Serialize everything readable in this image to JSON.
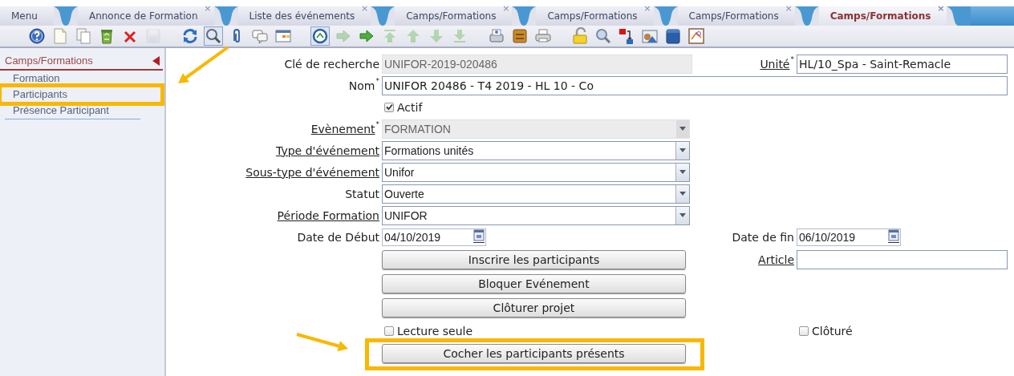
{
  "tabs": [
    {
      "label": "Menu",
      "selected": false
    },
    {
      "label": "Annonce de Formation",
      "close": "×",
      "selected": false
    },
    {
      "label": "Liste des événements",
      "close": "×",
      "selected": false
    },
    {
      "label": "Camps/Formations",
      "close": "×",
      "selected": false
    },
    {
      "label": "Camps/Formations",
      "close": "×",
      "selected": false
    },
    {
      "label": "Camps/Formations",
      "close": "×",
      "selected": false
    },
    {
      "label": "Camps/Formations",
      "close": "×",
      "selected": true
    }
  ],
  "toolbar": [
    {
      "kind": "help",
      "disabled": false,
      "pressed": false
    },
    {
      "kind": "new",
      "disabled": false,
      "pressed": false
    },
    {
      "kind": "copy",
      "disabled": false,
      "pressed": false
    },
    {
      "kind": "recycle",
      "disabled": false,
      "pressed": false
    },
    {
      "kind": "delete",
      "disabled": false,
      "pressed": false
    },
    {
      "kind": "save",
      "disabled": true,
      "pressed": false
    },
    {
      "kind": "refresh",
      "disabled": false,
      "pressed": false
    },
    {
      "kind": "search",
      "disabled": false,
      "pressed": true
    },
    {
      "kind": "clip",
      "disabled": false,
      "pressed": false
    },
    {
      "kind": "comments",
      "disabled": false,
      "pressed": false
    },
    {
      "kind": "table",
      "disabled": false,
      "pressed": false
    },
    {
      "kind": "history",
      "disabled": false,
      "pressed": true
    },
    {
      "kind": "forward",
      "disabled": true,
      "pressed": false
    },
    {
      "kind": "forward",
      "disabled": false,
      "pressed": false
    },
    {
      "kind": "top",
      "disabled": true,
      "pressed": false
    },
    {
      "kind": "up",
      "disabled": true,
      "pressed": false
    },
    {
      "kind": "down",
      "disabled": true,
      "pressed": false
    },
    {
      "kind": "bottom",
      "disabled": true,
      "pressed": false
    },
    {
      "kind": "scanner",
      "disabled": false,
      "pressed": false
    },
    {
      "kind": "drawer",
      "disabled": false,
      "pressed": false
    },
    {
      "kind": "printer",
      "disabled": false,
      "pressed": false
    },
    {
      "kind": "lock",
      "disabled": false,
      "pressed": false
    },
    {
      "kind": "zoom",
      "disabled": false,
      "pressed": false
    },
    {
      "kind": "transfer",
      "disabled": false,
      "pressed": false
    },
    {
      "kind": "photo",
      "disabled": false,
      "pressed": false
    },
    {
      "kind": "box",
      "disabled": false,
      "pressed": false
    },
    {
      "kind": "pdf",
      "disabled": false,
      "pressed": false
    }
  ],
  "sidebar": {
    "title": "Camps/Formations",
    "items": [
      {
        "label": "Formation",
        "highlighted": false
      },
      {
        "label": "Participants",
        "highlighted": true
      },
      {
        "label": "Présence Participant",
        "highlighted": false
      }
    ]
  },
  "form": {
    "rows": [
      {
        "left": {
          "kind": "text",
          "label": "Clé de recherche",
          "link": false,
          "value": "UNIFOR-2019-020486",
          "readonly": true
        },
        "right": {
          "kind": "text",
          "label": "Unité",
          "mark": "*",
          "link": true,
          "value": "HL/10_Spa - Saint-Remacle",
          "readonly": false
        }
      },
      {
        "left": {
          "kind": "text",
          "label": "Nom",
          "mark": "*",
          "link": false,
          "value": "UNIFOR 20486 - T4 2019 - HL 10 - Co",
          "readonly": false,
          "wide": true
        }
      },
      {
        "left": {
          "kind": "checkbox",
          "label": "Actif",
          "checked": true
        }
      },
      {
        "left": {
          "kind": "select",
          "label": "Evènement",
          "mark": "*",
          "link": true,
          "value": "FORMATION",
          "readonly": true
        }
      },
      {
        "left": {
          "kind": "select",
          "label": "Type d'événement",
          "link": true,
          "value": "Formations unités",
          "readonly": false
        }
      },
      {
        "left": {
          "kind": "select",
          "label": "Sous-type d'événement",
          "link": true,
          "value": "Unifor",
          "readonly": false
        }
      },
      {
        "left": {
          "kind": "select",
          "label": "Statut",
          "link": false,
          "value": "Ouverte",
          "readonly": false
        }
      },
      {
        "left": {
          "kind": "select",
          "label": "Période Formation",
          "link": true,
          "value": "UNIFOR",
          "readonly": false
        }
      },
      {
        "left": {
          "kind": "date",
          "label": "Date de Début",
          "link": false,
          "value": "04/10/2019"
        },
        "right": {
          "kind": "date",
          "label": "Date de fin",
          "link": false,
          "value": "06/10/2019"
        }
      },
      {
        "left": {
          "kind": "button",
          "label": "Inscrire les participants",
          "highlighted": false
        },
        "right": {
          "kind": "text",
          "label": "Article",
          "link": true,
          "readonly": false
        }
      },
      {
        "left": {
          "kind": "button",
          "label": "Bloquer Evénement",
          "highlighted": false
        }
      },
      {
        "left": {
          "kind": "button",
          "label": "Clôturer projet",
          "highlighted": false
        }
      },
      {
        "left": {
          "kind": "checkbox",
          "label": "Lecture seule",
          "checked": false
        },
        "right": {
          "kind": "checkbox",
          "label": "Clôturé",
          "checked": false
        }
      },
      {
        "left": {
          "kind": "button",
          "label": "Cocher les participants présents",
          "highlighted": true
        }
      }
    ]
  }
}
